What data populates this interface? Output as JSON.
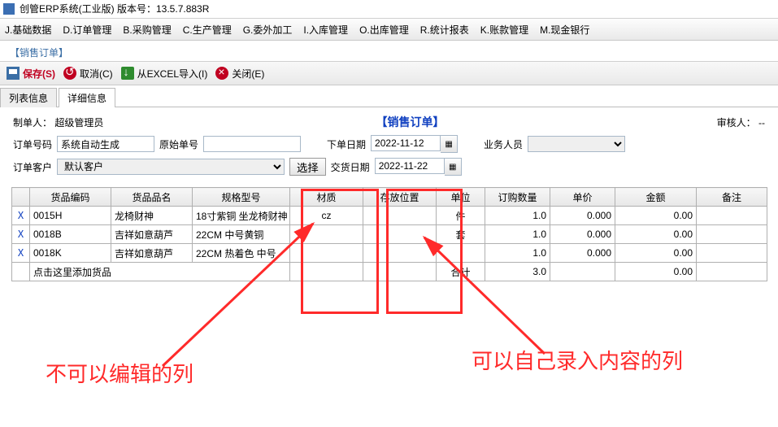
{
  "window": {
    "title": "创管ERP系统(工业版)  版本号：13.5.7.883R"
  },
  "menubar": [
    "J.基础数据",
    "D.订单管理",
    "B.采购管理",
    "C.生产管理",
    "G.委外加工",
    "I.入库管理",
    "O.出库管理",
    "R.统计报表",
    "K.账款管理",
    "M.现金银行"
  ],
  "section_title": "【销售订单】",
  "toolbar": {
    "save": "保存(S)",
    "cancel": "取消(C)",
    "import": "从EXCEL导入(I)",
    "close": "关闭(E)"
  },
  "tabs": {
    "list": "列表信息",
    "detail": "详细信息"
  },
  "header": {
    "maker_label": "制单人：",
    "maker_value": "超级管理员",
    "doc_title": "【销售订单】",
    "auditor_label": "审核人：",
    "auditor_value": "--"
  },
  "fields": {
    "order_no_label": "订单号码",
    "order_no_value": "系统自动生成",
    "orig_no_label": "原始单号",
    "orig_no_value": "",
    "order_date_label": "下单日期",
    "order_date_value": "2022-11-12",
    "sales_label": "业务人员",
    "sales_value": "",
    "customer_label": "订单客户",
    "customer_value": "默认客户",
    "select_btn": "选择",
    "deliver_date_label": "交货日期",
    "deliver_date_value": "2022-11-22"
  },
  "columns": [
    "",
    "货品编码",
    "货品品名",
    "规格型号",
    "材质",
    "存放位置",
    "单位",
    "订购数量",
    "单价",
    "金额",
    "备注"
  ],
  "rows": [
    {
      "mark": "X",
      "code": "0015H",
      "name": "龙椅财神",
      "spec": "18寸紫铜 坐龙椅财神",
      "mat": "cz",
      "loc": "",
      "unit": "件",
      "qty": "1.0",
      "price": "0.000",
      "amount": "0.00",
      "remark": ""
    },
    {
      "mark": "X",
      "code": "0018B",
      "name": "吉祥如意葫芦",
      "spec": "22CM 中号黄铜",
      "mat": "",
      "loc": "",
      "unit": "套",
      "qty": "1.0",
      "price": "0.000",
      "amount": "0.00",
      "remark": ""
    },
    {
      "mark": "X",
      "code": "0018K",
      "name": "吉祥如意葫芦",
      "spec": "22CM 热着色 中号",
      "mat": "",
      "loc": "",
      "unit": "",
      "qty": "1.0",
      "price": "0.000",
      "amount": "0.00",
      "remark": ""
    }
  ],
  "add_row_text": "点击这里添加货品",
  "totals": {
    "label": "合计",
    "qty": "3.0",
    "price": "",
    "amount": "0.00"
  },
  "annotations": {
    "left": "不可以编辑的列",
    "right": "可以自己录入内容的列"
  }
}
